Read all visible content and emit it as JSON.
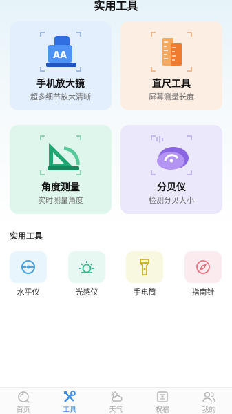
{
  "header": {
    "title": "实用工具"
  },
  "feature_cards": [
    {
      "name": "手机放大镜",
      "desc": "超多细节放大清晰",
      "icon": "magnifier-phone-icon"
    },
    {
      "name": "直尺工具",
      "desc": "屏幕测量长度",
      "icon": "ruler-icon"
    },
    {
      "name": "角度测量",
      "desc": "实时测量角度",
      "icon": "protractor-icon"
    },
    {
      "name": "分贝仪",
      "desc": "检测分贝大小",
      "icon": "decibel-meter-icon"
    }
  ],
  "section": {
    "title": "实用工具"
  },
  "tools": [
    {
      "label": "水平仪",
      "icon": "level-icon",
      "color": "#4aa3de"
    },
    {
      "label": "光感仪",
      "icon": "light-sensor-icon",
      "color": "#33b98a"
    },
    {
      "label": "手电筒",
      "icon": "flashlight-icon",
      "color": "#c9b12a"
    },
    {
      "label": "指南针",
      "icon": "compass-icon",
      "color": "#e8707d"
    }
  ],
  "tabbar": {
    "items": [
      {
        "label": "首页",
        "icon": "home-icon",
        "active": false
      },
      {
        "label": "工具",
        "icon": "tools-icon",
        "active": true
      },
      {
        "label": "天气",
        "icon": "weather-icon",
        "active": false
      },
      {
        "label": "祝福",
        "icon": "blessing-icon",
        "active": false
      },
      {
        "label": "我的",
        "icon": "profile-icon",
        "active": false
      }
    ]
  },
  "colors": {
    "accent": "#3a8ee6",
    "inactive": "#aaaaaa"
  }
}
